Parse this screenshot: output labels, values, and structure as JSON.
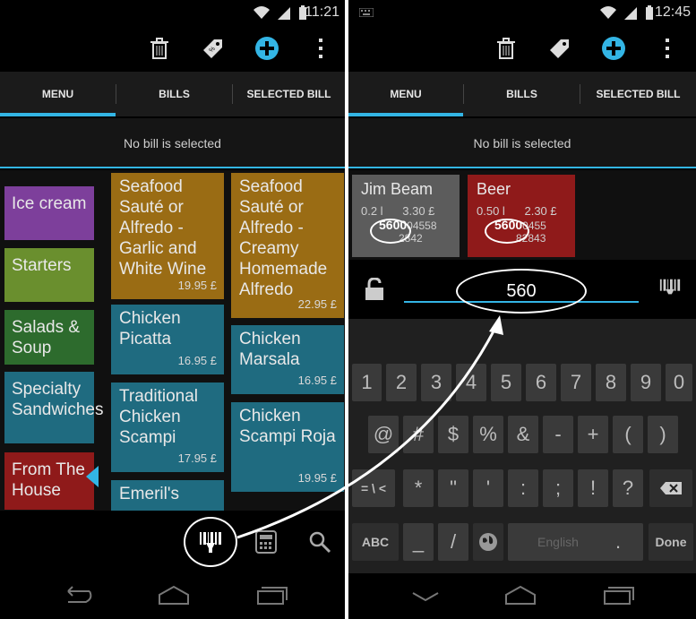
{
  "left": {
    "status_time": "11:21",
    "tabs": [
      "MENU",
      "BILLS",
      "SELECTED BILL"
    ],
    "bill_status": "No bill is selected",
    "categories": [
      {
        "label": "Ice cream",
        "color": "#7d3f9b"
      },
      {
        "label": "Starters",
        "color": "#6a8f2e"
      },
      {
        "label": "Salads & Soup",
        "color": "#2d6b2d"
      },
      {
        "label": "Specialty Sandwiches",
        "color": "#1f6b80"
      },
      {
        "label": "From The House",
        "color": "#8f1a1a"
      }
    ],
    "items_col1": [
      {
        "name": "Seafood Sauté or Alfredo - Garlic and White Wine",
        "price": "19.95 £",
        "color": "#9a6c14"
      },
      {
        "name": "Chicken Picatta",
        "price": "16.95 £",
        "color": "#1f6b80"
      },
      {
        "name": "Traditional Chicken Scampi",
        "price": "17.95 £",
        "color": "#1f6b80"
      },
      {
        "name": "Emeril's",
        "price": "",
        "color": "#1f6b80"
      }
    ],
    "items_col2": [
      {
        "name": "Seafood Sauté or Alfredo - Creamy Homemade Alfredo",
        "price": "22.95 £",
        "color": "#9a6c14"
      },
      {
        "name": "Chicken Marsala",
        "price": "16.95 £",
        "color": "#1f6b80"
      },
      {
        "name": "Chicken Scampi Roja",
        "price": "19.95 £",
        "color": "#1f6b80"
      }
    ]
  },
  "right": {
    "status_time": "12:45",
    "tabs": [
      "MENU",
      "BILLS",
      "SELECTED BILL"
    ],
    "bill_status": "No bill is selected",
    "products": [
      {
        "name": "Jim Beam",
        "line2a": "0.2 l",
        "line2b": "3.30 £",
        "barcode_a": "5600",
        "barcode_b": "04558",
        "line3": "2842",
        "color": "#5c5c5c"
      },
      {
        "name": "Beer",
        "line2a": "0.50 l",
        "line2b": "2.30 £",
        "barcode_a": "5600",
        "barcode_b": "0455",
        "line3": "82843",
        "color": "#8f1a1a"
      }
    ],
    "search_value": "560",
    "keyboard": {
      "row1": [
        "1",
        "2",
        "3",
        "4",
        "5",
        "6",
        "7",
        "8",
        "9",
        "0"
      ],
      "row2": [
        "@",
        "#",
        "$",
        "%",
        "&",
        "-",
        "+",
        "(",
        ")"
      ],
      "row3": [
        "= \\ <",
        "*",
        "\"",
        "'",
        ":",
        ";",
        "!",
        "?"
      ],
      "row4": [
        "ABC",
        "_",
        "/",
        "English",
        ",",
        ".",
        "Done"
      ]
    }
  }
}
